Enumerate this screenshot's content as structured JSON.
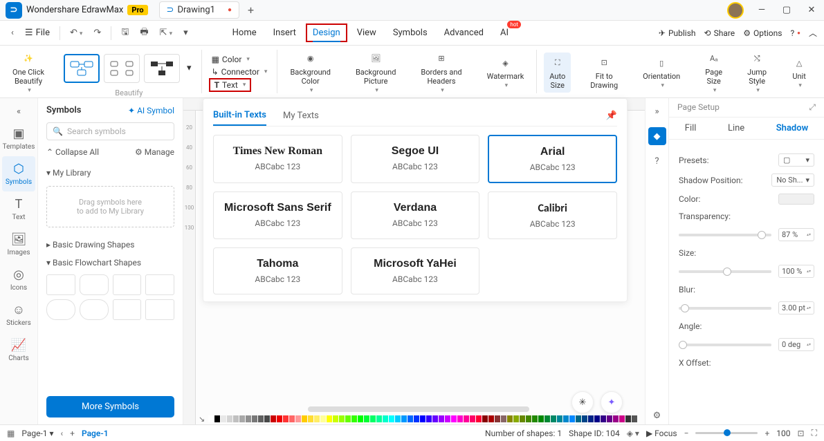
{
  "titlebar": {
    "app_name": "Wondershare EdrawMax",
    "badge": "Pro",
    "tab_name": "Drawing1",
    "add_tab": "+"
  },
  "menubar": {
    "file": "File",
    "items": [
      "Home",
      "Insert",
      "Design",
      "View",
      "Symbols",
      "Advanced",
      "AI"
    ],
    "hot": "hot",
    "publish": "Publish",
    "share": "Share",
    "options": "Options"
  },
  "ribbon": {
    "one_click": "One Click\nBeautify",
    "beautify_label": "Beautify",
    "color": "Color",
    "connector": "Connector",
    "text": "Text",
    "bg_color": "Background\nColor",
    "bg_picture": "Background\nPicture",
    "borders": "Borders and\nHeaders",
    "watermark": "Watermark",
    "auto_size": "Auto\nSize",
    "fit": "Fit to\nDrawing",
    "orientation": "Orientation",
    "page_size": "Page\nSize",
    "jump_style": "Jump\nStyle",
    "unit": "Unit",
    "page_setup": "Page Setup"
  },
  "left_rail": {
    "templates": "Templates",
    "symbols": "Symbols",
    "text": "Text",
    "images": "Images",
    "icons": "Icons",
    "stickers": "Stickers",
    "charts": "Charts"
  },
  "sym_panel": {
    "title": "Symbols",
    "ai_symbol": "AI Symbol",
    "search_ph": "Search symbols",
    "collapse": "Collapse All",
    "manage": "Manage",
    "my_library": "My Library",
    "drag_hint1": "Drag symbols here",
    "drag_hint2": "to add to My Library",
    "basic_drawing": "Basic Drawing Shapes",
    "basic_flowchart": "Basic Flowchart Shapes",
    "more": "More Symbols"
  },
  "text_popup": {
    "builtin": "Built-in Texts",
    "my_texts": "My Texts",
    "fonts": [
      {
        "name": "Times New Roman",
        "sample": "ABCabc 123",
        "family": "'Times New Roman', serif"
      },
      {
        "name": "Segoe UI",
        "sample": "ABCabc 123",
        "family": "'Segoe UI', sans-serif"
      },
      {
        "name": "Arial",
        "sample": "ABCabc 123",
        "family": "Arial, sans-serif",
        "selected": true
      },
      {
        "name": "Microsoft Sans Serif",
        "sample": "ABCabc 123",
        "family": "'Microsoft Sans Serif', sans-serif"
      },
      {
        "name": "Verdana",
        "sample": "ABCabc 123",
        "family": "Verdana, sans-serif"
      },
      {
        "name": "Calibri",
        "sample": "ABCabc 123",
        "family": "Calibri, sans-serif"
      },
      {
        "name": "Tahoma",
        "sample": "ABCabc 123",
        "family": "Tahoma, sans-serif"
      },
      {
        "name": "Microsoft YaHei",
        "sample": "ABCabc 123",
        "family": "'Microsoft YaHei', sans-serif"
      }
    ]
  },
  "right_panel": {
    "page_setup": "Page Setup",
    "fill": "Fill",
    "line": "Line",
    "shadow": "Shadow",
    "presets": "Presets:",
    "shadow_position": "Shadow Position:",
    "shadow_pos_val": "No Sh...",
    "color": "Color:",
    "transparency": "Transparency:",
    "transparency_val": "87 %",
    "size": "Size:",
    "size_val": "100 %",
    "blur": "Blur:",
    "blur_val": "3.00 pt",
    "angle": "Angle:",
    "angle_val": "0 deg",
    "x_offset": "X Offset:"
  },
  "statusbar": {
    "page_dropdown": "Page-1",
    "page_tab": "Page-1",
    "shapes": "Number of shapes: 1",
    "shape_id": "Shape ID: 104",
    "focus": "Focus",
    "zoom": "100"
  },
  "ruler_marks": [
    "20",
    "40",
    "60",
    "80",
    "100",
    "130"
  ],
  "color_swatches": [
    "#fff",
    "#000",
    "#e8e8e8",
    "#d4d4d4",
    "#c0c0c0",
    "#a8a8a8",
    "#909090",
    "#787878",
    "#606060",
    "#484848",
    "#c00",
    "#e00",
    "#f33",
    "#f66",
    "#f99",
    "#fc0",
    "#fd3",
    "#fe6",
    "#ff9",
    "#ff0",
    "#cf0",
    "#9f0",
    "#6f0",
    "#3f0",
    "#0f0",
    "#0f3",
    "#0f6",
    "#0f9",
    "#0fc",
    "#0ff",
    "#0cf",
    "#09f",
    "#06f",
    "#03f",
    "#00f",
    "#30f",
    "#60f",
    "#90f",
    "#c0f",
    "#f0f",
    "#f0c",
    "#f09",
    "#f06",
    "#f03",
    "#800",
    "#a00",
    "#833",
    "#866",
    "#880",
    "#8a0",
    "#680",
    "#480",
    "#280",
    "#080",
    "#083",
    "#086",
    "#089",
    "#08c",
    "#08f",
    "#068",
    "#048",
    "#028",
    "#008",
    "#308",
    "#608",
    "#908",
    "#c08",
    "#333",
    "#555",
    "#777",
    "#999",
    "#bbb"
  ]
}
